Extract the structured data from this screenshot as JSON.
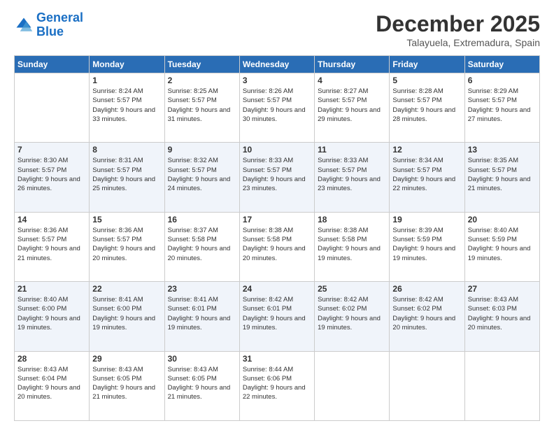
{
  "logo": {
    "line1": "General",
    "line2": "Blue"
  },
  "header": {
    "month": "December 2025",
    "location": "Talayuela, Extremadura, Spain"
  },
  "days_of_week": [
    "Sunday",
    "Monday",
    "Tuesday",
    "Wednesday",
    "Thursday",
    "Friday",
    "Saturday"
  ],
  "weeks": [
    [
      {
        "day": "",
        "sunrise": "",
        "sunset": "",
        "daylight": ""
      },
      {
        "day": "1",
        "sunrise": "Sunrise: 8:24 AM",
        "sunset": "Sunset: 5:57 PM",
        "daylight": "Daylight: 9 hours and 33 minutes."
      },
      {
        "day": "2",
        "sunrise": "Sunrise: 8:25 AM",
        "sunset": "Sunset: 5:57 PM",
        "daylight": "Daylight: 9 hours and 31 minutes."
      },
      {
        "day": "3",
        "sunrise": "Sunrise: 8:26 AM",
        "sunset": "Sunset: 5:57 PM",
        "daylight": "Daylight: 9 hours and 30 minutes."
      },
      {
        "day": "4",
        "sunrise": "Sunrise: 8:27 AM",
        "sunset": "Sunset: 5:57 PM",
        "daylight": "Daylight: 9 hours and 29 minutes."
      },
      {
        "day": "5",
        "sunrise": "Sunrise: 8:28 AM",
        "sunset": "Sunset: 5:57 PM",
        "daylight": "Daylight: 9 hours and 28 minutes."
      },
      {
        "day": "6",
        "sunrise": "Sunrise: 8:29 AM",
        "sunset": "Sunset: 5:57 PM",
        "daylight": "Daylight: 9 hours and 27 minutes."
      }
    ],
    [
      {
        "day": "7",
        "sunrise": "Sunrise: 8:30 AM",
        "sunset": "Sunset: 5:57 PM",
        "daylight": "Daylight: 9 hours and 26 minutes."
      },
      {
        "day": "8",
        "sunrise": "Sunrise: 8:31 AM",
        "sunset": "Sunset: 5:57 PM",
        "daylight": "Daylight: 9 hours and 25 minutes."
      },
      {
        "day": "9",
        "sunrise": "Sunrise: 8:32 AM",
        "sunset": "Sunset: 5:57 PM",
        "daylight": "Daylight: 9 hours and 24 minutes."
      },
      {
        "day": "10",
        "sunrise": "Sunrise: 8:33 AM",
        "sunset": "Sunset: 5:57 PM",
        "daylight": "Daylight: 9 hours and 23 minutes."
      },
      {
        "day": "11",
        "sunrise": "Sunrise: 8:33 AM",
        "sunset": "Sunset: 5:57 PM",
        "daylight": "Daylight: 9 hours and 23 minutes."
      },
      {
        "day": "12",
        "sunrise": "Sunrise: 8:34 AM",
        "sunset": "Sunset: 5:57 PM",
        "daylight": "Daylight: 9 hours and 22 minutes."
      },
      {
        "day": "13",
        "sunrise": "Sunrise: 8:35 AM",
        "sunset": "Sunset: 5:57 PM",
        "daylight": "Daylight: 9 hours and 21 minutes."
      }
    ],
    [
      {
        "day": "14",
        "sunrise": "Sunrise: 8:36 AM",
        "sunset": "Sunset: 5:57 PM",
        "daylight": "Daylight: 9 hours and 21 minutes."
      },
      {
        "day": "15",
        "sunrise": "Sunrise: 8:36 AM",
        "sunset": "Sunset: 5:57 PM",
        "daylight": "Daylight: 9 hours and 20 minutes."
      },
      {
        "day": "16",
        "sunrise": "Sunrise: 8:37 AM",
        "sunset": "Sunset: 5:58 PM",
        "daylight": "Daylight: 9 hours and 20 minutes."
      },
      {
        "day": "17",
        "sunrise": "Sunrise: 8:38 AM",
        "sunset": "Sunset: 5:58 PM",
        "daylight": "Daylight: 9 hours and 20 minutes."
      },
      {
        "day": "18",
        "sunrise": "Sunrise: 8:38 AM",
        "sunset": "Sunset: 5:58 PM",
        "daylight": "Daylight: 9 hours and 19 minutes."
      },
      {
        "day": "19",
        "sunrise": "Sunrise: 8:39 AM",
        "sunset": "Sunset: 5:59 PM",
        "daylight": "Daylight: 9 hours and 19 minutes."
      },
      {
        "day": "20",
        "sunrise": "Sunrise: 8:40 AM",
        "sunset": "Sunset: 5:59 PM",
        "daylight": "Daylight: 9 hours and 19 minutes."
      }
    ],
    [
      {
        "day": "21",
        "sunrise": "Sunrise: 8:40 AM",
        "sunset": "Sunset: 6:00 PM",
        "daylight": "Daylight: 9 hours and 19 minutes."
      },
      {
        "day": "22",
        "sunrise": "Sunrise: 8:41 AM",
        "sunset": "Sunset: 6:00 PM",
        "daylight": "Daylight: 9 hours and 19 minutes."
      },
      {
        "day": "23",
        "sunrise": "Sunrise: 8:41 AM",
        "sunset": "Sunset: 6:01 PM",
        "daylight": "Daylight: 9 hours and 19 minutes."
      },
      {
        "day": "24",
        "sunrise": "Sunrise: 8:42 AM",
        "sunset": "Sunset: 6:01 PM",
        "daylight": "Daylight: 9 hours and 19 minutes."
      },
      {
        "day": "25",
        "sunrise": "Sunrise: 8:42 AM",
        "sunset": "Sunset: 6:02 PM",
        "daylight": "Daylight: 9 hours and 19 minutes."
      },
      {
        "day": "26",
        "sunrise": "Sunrise: 8:42 AM",
        "sunset": "Sunset: 6:02 PM",
        "daylight": "Daylight: 9 hours and 20 minutes."
      },
      {
        "day": "27",
        "sunrise": "Sunrise: 8:43 AM",
        "sunset": "Sunset: 6:03 PM",
        "daylight": "Daylight: 9 hours and 20 minutes."
      }
    ],
    [
      {
        "day": "28",
        "sunrise": "Sunrise: 8:43 AM",
        "sunset": "Sunset: 6:04 PM",
        "daylight": "Daylight: 9 hours and 20 minutes."
      },
      {
        "day": "29",
        "sunrise": "Sunrise: 8:43 AM",
        "sunset": "Sunset: 6:05 PM",
        "daylight": "Daylight: 9 hours and 21 minutes."
      },
      {
        "day": "30",
        "sunrise": "Sunrise: 8:43 AM",
        "sunset": "Sunset: 6:05 PM",
        "daylight": "Daylight: 9 hours and 21 minutes."
      },
      {
        "day": "31",
        "sunrise": "Sunrise: 8:44 AM",
        "sunset": "Sunset: 6:06 PM",
        "daylight": "Daylight: 9 hours and 22 minutes."
      },
      {
        "day": "",
        "sunrise": "",
        "sunset": "",
        "daylight": ""
      },
      {
        "day": "",
        "sunrise": "",
        "sunset": "",
        "daylight": ""
      },
      {
        "day": "",
        "sunrise": "",
        "sunset": "",
        "daylight": ""
      }
    ]
  ]
}
